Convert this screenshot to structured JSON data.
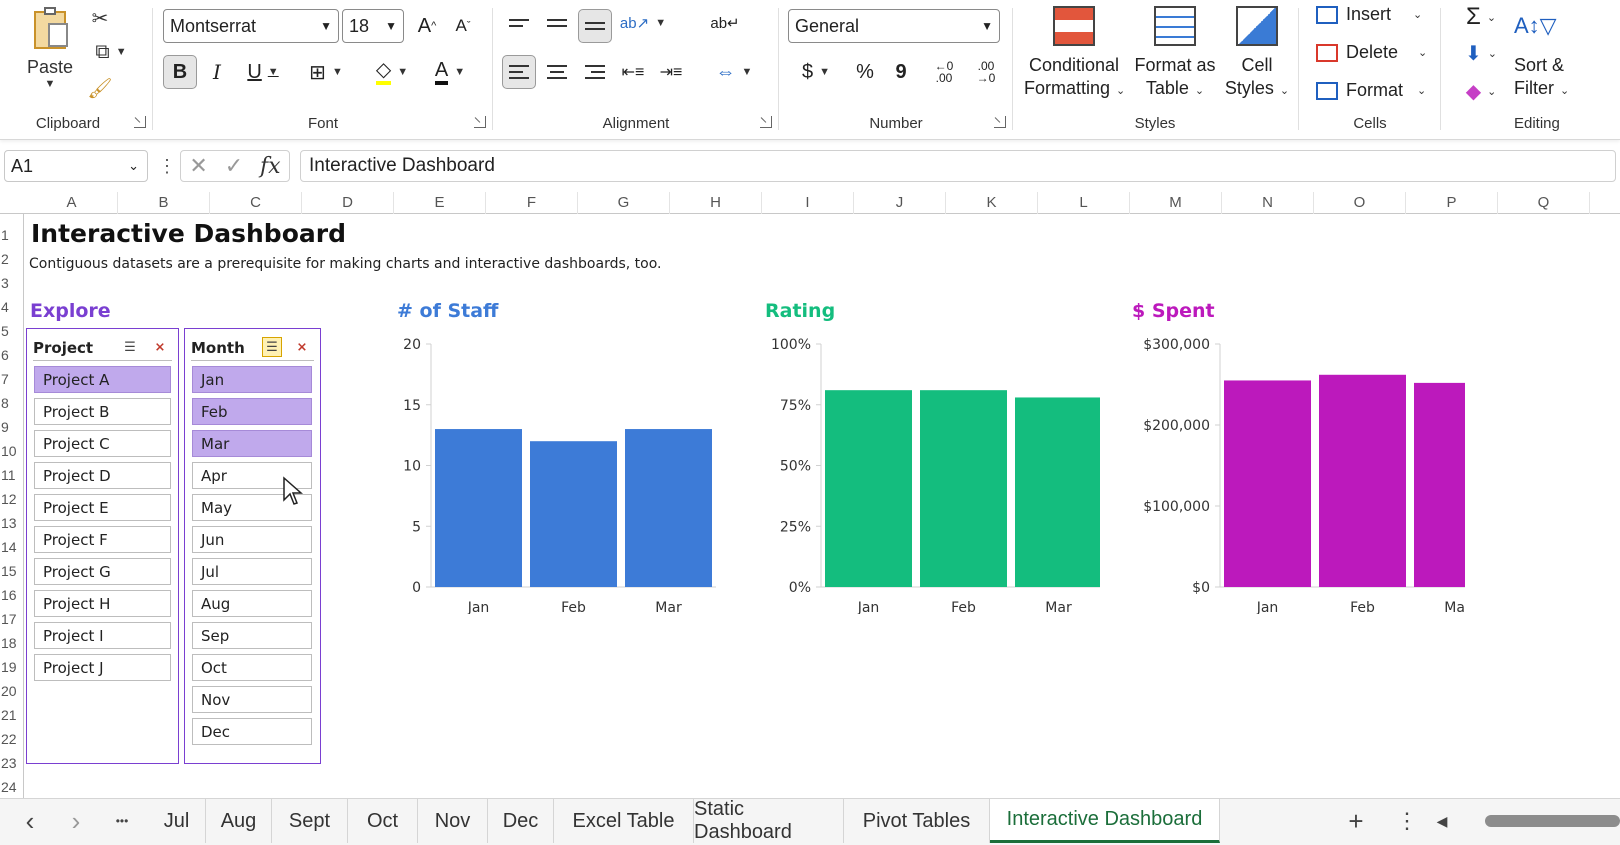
{
  "ribbon": {
    "clipboard": {
      "paste_label": "Paste",
      "group_label": "Clipboard"
    },
    "font": {
      "family": "Montserrat",
      "size": "18",
      "group_label": "Font",
      "bold": "B",
      "italic": "I",
      "underline": "U",
      "grow": "A",
      "shrink": "A"
    },
    "alignment": {
      "group_label": "Alignment"
    },
    "number": {
      "format": "General",
      "group_label": "Number",
      "currency": "$",
      "percent": "%",
      "comma": "9",
      "inc_decimal": "←0 .00",
      "dec_decimal": ".00 →0"
    },
    "styles": {
      "group_label": "Styles",
      "conditional_line1": "Conditional",
      "conditional_line2": "Formatting",
      "format_table_line1": "Format as",
      "format_table_line2": "Table",
      "cell_styles_line1": "Cell",
      "cell_styles_line2": "Styles"
    },
    "cells": {
      "group_label": "Cells",
      "insert": "Insert",
      "delete": "Delete",
      "format": "Format"
    },
    "editing": {
      "group_label": "Editing",
      "sort_line1": "Sort &",
      "sort_line2": "Filter"
    }
  },
  "formula_bar": {
    "name_box": "A1",
    "fx": "fx",
    "formula": "Interactive Dashboard"
  },
  "columns": [
    "A",
    "B",
    "C",
    "D",
    "E",
    "F",
    "G",
    "H",
    "I",
    "J",
    "K",
    "L",
    "M",
    "N",
    "O",
    "P",
    "Q"
  ],
  "rows": [
    "1",
    "2",
    "3",
    "4",
    "5",
    "6",
    "7",
    "8",
    "9",
    "10",
    "11",
    "12",
    "13",
    "14",
    "15",
    "16",
    "17",
    "18",
    "19",
    "20",
    "21",
    "22",
    "23",
    "24"
  ],
  "sheet": {
    "title": "Interactive Dashboard",
    "subtitle": "Contiguous datasets are a prerequisite for making charts and interactive dashboards, too.",
    "explore_label": "Explore",
    "project_slicer": {
      "header": "Project",
      "items": [
        "Project A",
        "Project B",
        "Project C",
        "Project D",
        "Project E",
        "Project F",
        "Project G",
        "Project H",
        "Project I",
        "Project J"
      ],
      "selected": [
        "Project A"
      ]
    },
    "month_slicer": {
      "header": "Month",
      "items": [
        "Jan",
        "Feb",
        "Mar",
        "Apr",
        "May",
        "Jun",
        "Jul",
        "Aug",
        "Sep",
        "Oct",
        "Nov",
        "Dec"
      ],
      "selected": [
        "Jan",
        "Feb",
        "Mar"
      ]
    }
  },
  "colors": {
    "staff": "#3d7bd7",
    "rating": "#14bd7e",
    "spent": "#bc19bc",
    "explore": "#7a3fd1",
    "slicer_selected": "#c0a9ec",
    "active_tab": "#1b6e3a"
  },
  "chart_data": [
    {
      "type": "bar",
      "title": "# of Staff",
      "categories": [
        "Jan",
        "Feb",
        "Mar"
      ],
      "values": [
        13,
        12,
        13
      ],
      "ylim": [
        0,
        20
      ],
      "yticks": [
        "0",
        "5",
        "10",
        "15",
        "20"
      ]
    },
    {
      "type": "bar",
      "title": "Rating",
      "categories": [
        "Jan",
        "Feb",
        "Mar"
      ],
      "values": [
        0.81,
        0.81,
        0.78
      ],
      "ylim": [
        0,
        1
      ],
      "yticks": [
        "0%",
        "25%",
        "50%",
        "75%",
        "100%"
      ]
    },
    {
      "type": "bar",
      "title": "$ Spent",
      "categories": [
        "Jan",
        "Feb",
        "Mar"
      ],
      "values": [
        255000,
        262000,
        252000
      ],
      "ylim": [
        0,
        300000
      ],
      "yticks": [
        "$0",
        "$100,000",
        "$200,000",
        "$300,000"
      ]
    }
  ],
  "tabs": {
    "nav_prev": "‹",
    "nav_next": "›",
    "more": "•••",
    "items": [
      "Jul",
      "Aug",
      "Sept",
      "Oct",
      "Nov",
      "Dec",
      "Excel Table",
      "Static Dashboard",
      "Pivot Tables",
      "Interactive Dashboard"
    ],
    "active": "Interactive Dashboard",
    "add": "+",
    "options": "⋮"
  }
}
